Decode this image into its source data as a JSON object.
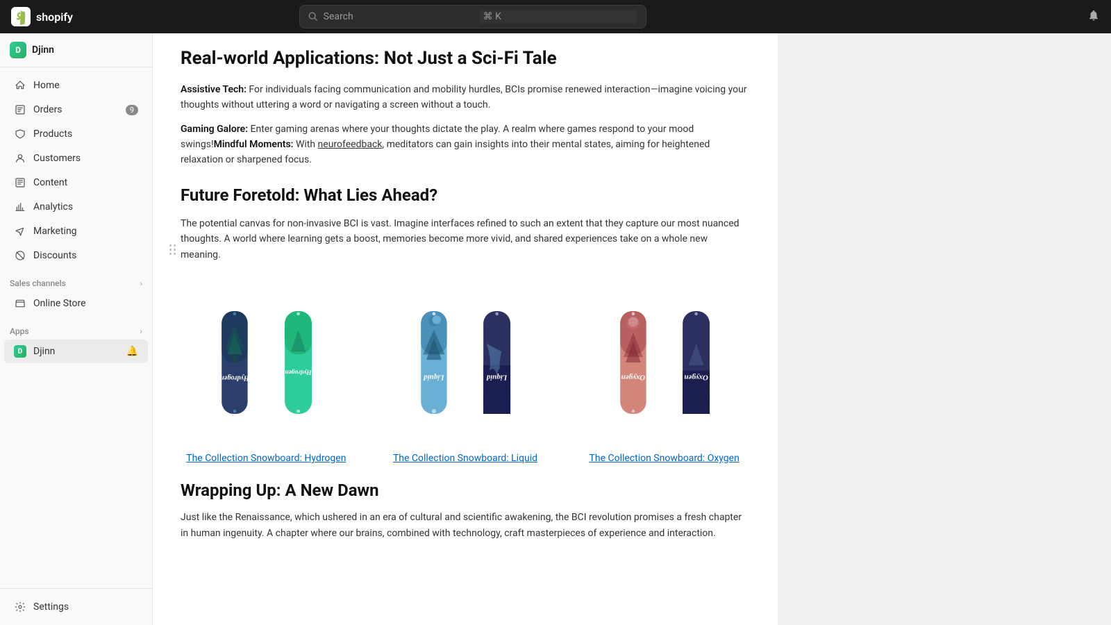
{
  "topbar": {
    "logo_text": "shopify",
    "search_placeholder": "Search",
    "search_shortcut": "⌘ K"
  },
  "sidebar": {
    "app_name": "Djinn",
    "nav_items": [
      {
        "id": "home",
        "label": "Home",
        "icon": "home"
      },
      {
        "id": "orders",
        "label": "Orders",
        "icon": "orders",
        "badge": "9"
      },
      {
        "id": "products",
        "label": "Products",
        "icon": "products"
      },
      {
        "id": "customers",
        "label": "Customers",
        "icon": "customers"
      },
      {
        "id": "content",
        "label": "Content",
        "icon": "content"
      },
      {
        "id": "analytics",
        "label": "Analytics",
        "icon": "analytics"
      },
      {
        "id": "marketing",
        "label": "Marketing",
        "icon": "marketing"
      },
      {
        "id": "discounts",
        "label": "Discounts",
        "icon": "discounts"
      }
    ],
    "sales_channels_label": "Sales channels",
    "online_store_label": "Online Store",
    "apps_label": "Apps",
    "djinn_label": "Djinn",
    "settings_label": "Settings"
  },
  "content": {
    "section1_title": "Real-world Applications: Not Just a Sci-Fi Tale",
    "para1_label1": "Assistive Tech:",
    "para1_text1": " For individuals facing communication and mobility hurdles, BCIs promise renewed interaction—imagine voicing your thoughts without uttering a word or navigating a screen without a touch.",
    "para2_label1": "Gaming Galore:",
    "para2_text1": " Enter gaming arenas where your thoughts dictate the play. A realm where games respond to your mood swings!",
    "para2_label2": "Mindful Moments:",
    "para2_text2": " With ",
    "para2_link": "neurofeedback",
    "para2_text3": ", meditators can gain insights into their mental states, aiming for heightened relaxation or sharpened focus.",
    "section2_title": "Future Foretold: What Lies Ahead?",
    "para3": "The potential canvas for non-invasive BCI is vast. Imagine interfaces refined to such an extent that they capture our most nuanced thoughts. A world where learning gets a boost, memories become more vivid, and shared experiences take on a whole new meaning.",
    "products": [
      {
        "name": "hydrogen",
        "link": "The Collection Snowboard: Hydrogen",
        "board1_color_top": "#2c3e6b",
        "board1_color_bottom": "#1a2a4a",
        "board1_text": "Hydrogen",
        "board2_color_top": "#2ecc9a",
        "board2_color_bottom": "#27ae6a",
        "board2_text": "Hydrogen"
      },
      {
        "name": "liquid",
        "link": "The Collection Snowboard: Liquid",
        "board1_color_top": "#5fa8d3",
        "board1_color_bottom": "#4a8ab8",
        "board1_text": "Liquid",
        "board2_color_top": "#2c3060",
        "board2_color_bottom": "#1a1f4a",
        "board2_text": "Liquid"
      },
      {
        "name": "oxygen",
        "link": "The Collection Snowboard: Oxygen",
        "board1_color_top": "#e8a0a0",
        "board1_color_bottom": "#c47070",
        "board1_text": "Oxygen",
        "board2_color_top": "#2c3060",
        "board2_color_bottom": "#1a1f4a",
        "board2_text": "Oxygen"
      }
    ],
    "section3_title": "Wrapping Up: A New Dawn",
    "para4": "Just like the Renaissance, which ushered in an era of cultural and scientific awakening, the BCI revolution promises a fresh chapter in human ingenuity. A chapter where our brains, combined with technology, craft masterpieces of experience and interaction."
  }
}
